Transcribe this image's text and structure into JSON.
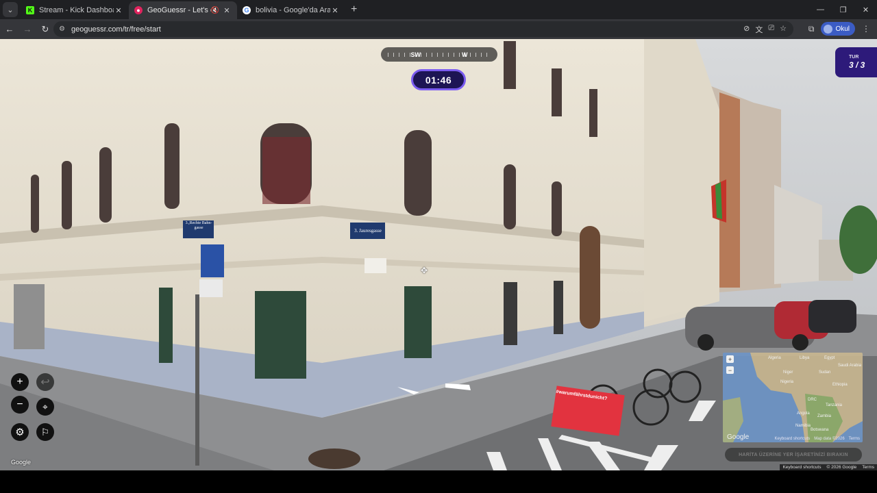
{
  "browser": {
    "tabs": [
      {
        "title": "Stream - Kick Dashboard",
        "favicon": "kick-icon",
        "color": "#53fc18",
        "active": false
      },
      {
        "title": "GeoGuessr - Let's explore th",
        "favicon": "geoguessr-pin-icon",
        "color": "#e0245e",
        "active": true,
        "muted": true
      },
      {
        "title": "bolivia - Google'da Ara",
        "favicon": "google-icon",
        "color": "#4285f4",
        "active": false
      }
    ],
    "url": "geoguessr.com/tr/free/start",
    "profile_label": "Okul"
  },
  "game": {
    "compass": {
      "left_label": "SW",
      "right_label": "W"
    },
    "timer": "01:46",
    "round_label": "TUR",
    "round_value": "3 / 3",
    "place_button": "HARİTA ÜZERİNE YER İŞARETİNİZİ BIRAKIN",
    "google_logo": "Google"
  },
  "minimap": {
    "labels": [
      "Algeria",
      "Libya",
      "Egypt",
      "Saudi Arabia",
      "Niger",
      "Sudan",
      "Nigeria",
      "Ethiopia",
      "DRC",
      "Tanzania",
      "Angola",
      "Zambia",
      "Namibia",
      "Botswana"
    ],
    "google_logo": "Google",
    "caption": [
      "Keyboard shortcuts",
      "Map data ©2026",
      "Terms"
    ]
  },
  "street_view_footer": [
    "Keyboard shortcuts",
    "© 2026 Google",
    "Terms"
  ],
  "street_signs": {
    "sign1_line1": "3.,Rechte Bahn-",
    "sign1_line2": "gasse",
    "sign2": "3. Jauresgasse",
    "banner": "#warumfährstdunicht?"
  }
}
